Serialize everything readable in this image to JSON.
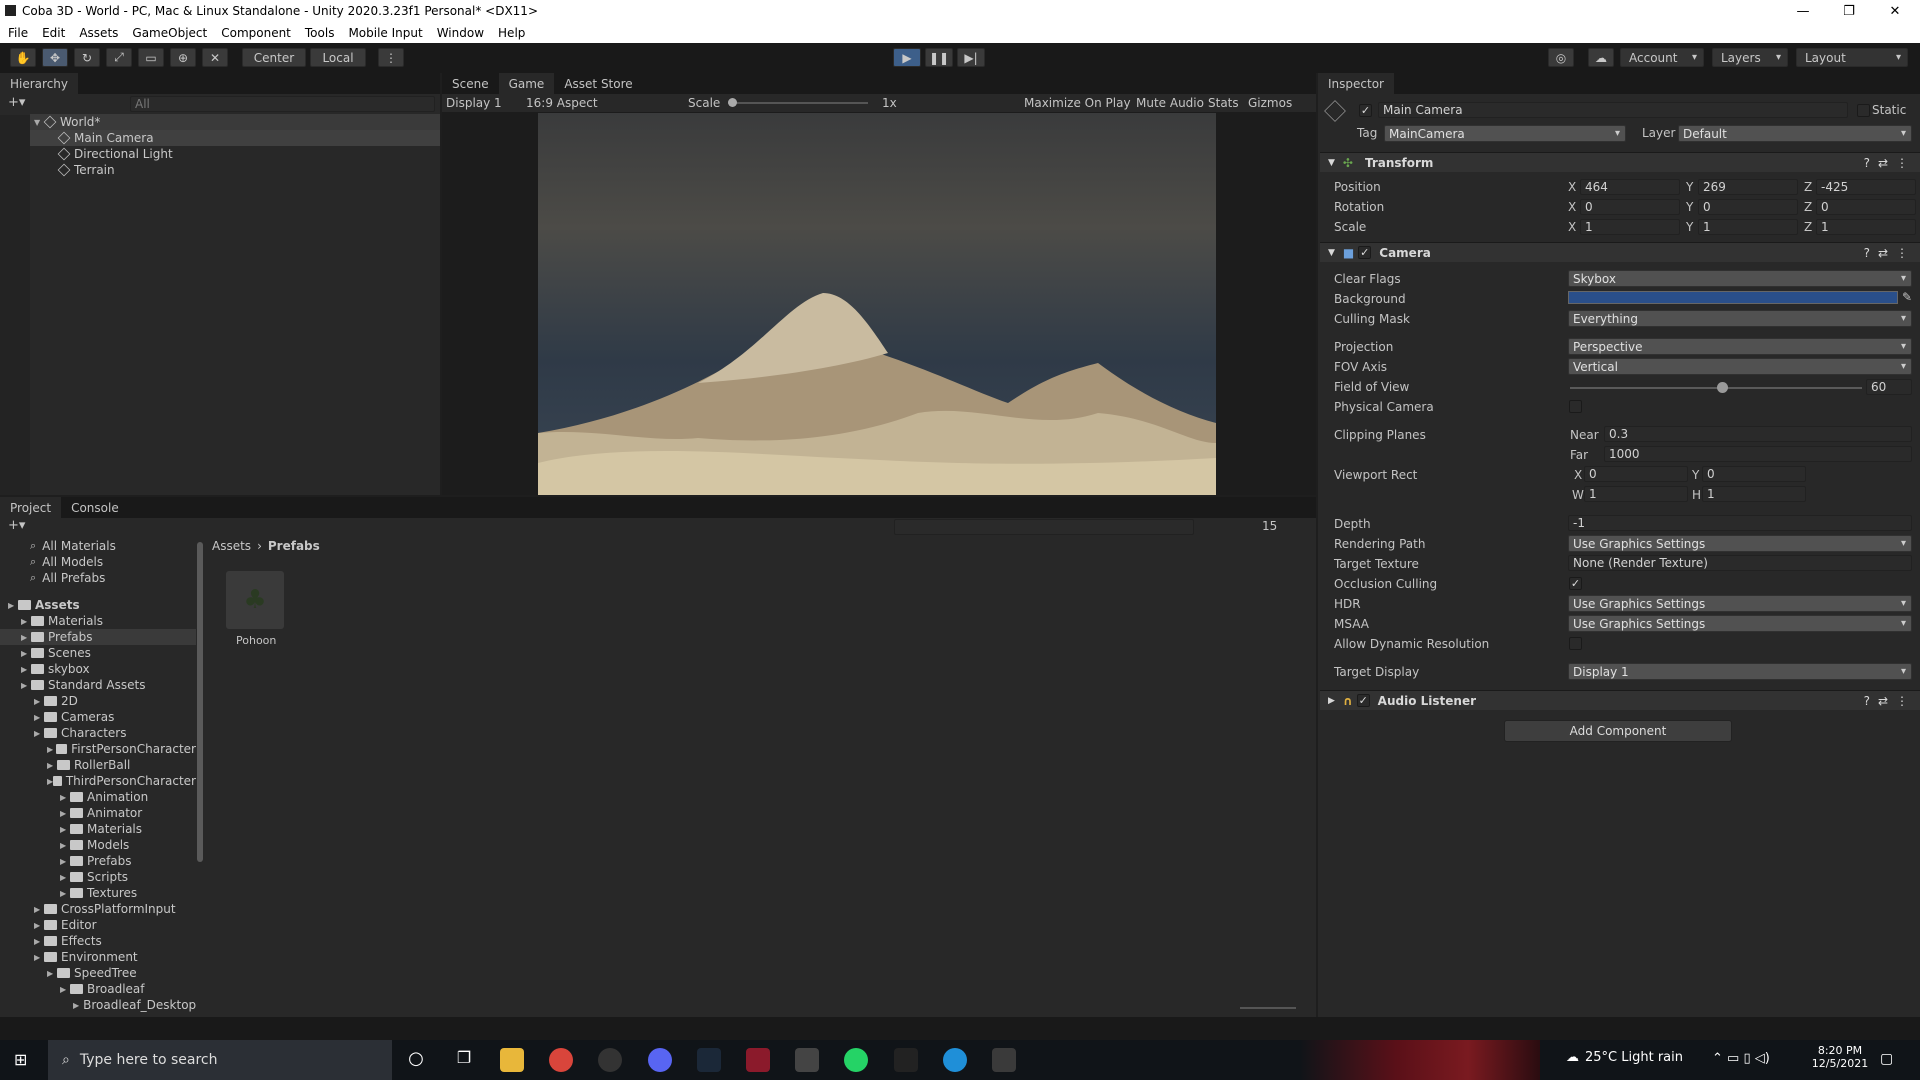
{
  "window": {
    "title": "Coba 3D - World - PC, Mac & Linux Standalone - Unity 2020.3.23f1 Personal* <DX11>"
  },
  "menu": [
    "File",
    "Edit",
    "Assets",
    "GameObject",
    "Component",
    "Tools",
    "Mobile Input",
    "Window",
    "Help"
  ],
  "toolbar": {
    "center": "Center",
    "local": "Local",
    "account": "Account",
    "layers": "Layers",
    "layout": "Layout"
  },
  "hierarchy": {
    "tab": "Hierarchy",
    "search_placeholder": "All",
    "scene": "World*",
    "items": [
      "Main Camera",
      "Directional Light",
      "Terrain"
    ]
  },
  "scene_tabs": [
    "Scene",
    "Game",
    "Asset Store"
  ],
  "game_bar": {
    "display": "Display 1",
    "aspect": "16:9 Aspect",
    "scale_label": "Scale",
    "scale_value": "1x",
    "maximize": "Maximize On Play",
    "mute": "Mute Audio",
    "stats": "Stats",
    "gizmos": "Gizmos"
  },
  "project": {
    "tabs": [
      "Project",
      "Console"
    ],
    "favorites": [
      "All Materials",
      "All Models",
      "All Prefabs"
    ],
    "tree": [
      {
        "label": "Assets",
        "depth": 0,
        "bold": true
      },
      {
        "label": "Materials",
        "depth": 1
      },
      {
        "label": "Prefabs",
        "depth": 1,
        "selected": true
      },
      {
        "label": "Scenes",
        "depth": 1
      },
      {
        "label": "skybox",
        "depth": 1
      },
      {
        "label": "Standard Assets",
        "depth": 1
      },
      {
        "label": "2D",
        "depth": 2
      },
      {
        "label": "Cameras",
        "depth": 2
      },
      {
        "label": "Characters",
        "depth": 2
      },
      {
        "label": "FirstPersonCharacter",
        "depth": 3
      },
      {
        "label": "RollerBall",
        "depth": 3
      },
      {
        "label": "ThirdPersonCharacter",
        "depth": 3
      },
      {
        "label": "Animation",
        "depth": 4
      },
      {
        "label": "Animator",
        "depth": 4
      },
      {
        "label": "Materials",
        "depth": 4
      },
      {
        "label": "Models",
        "depth": 4
      },
      {
        "label": "Prefabs",
        "depth": 4
      },
      {
        "label": "Scripts",
        "depth": 4
      },
      {
        "label": "Textures",
        "depth": 4
      },
      {
        "label": "CrossPlatformInput",
        "depth": 2
      },
      {
        "label": "Editor",
        "depth": 2
      },
      {
        "label": "Effects",
        "depth": 2
      },
      {
        "label": "Environment",
        "depth": 2
      },
      {
        "label": "SpeedTree",
        "depth": 3
      },
      {
        "label": "Broadleaf",
        "depth": 4
      },
      {
        "label": "Broadleaf_Desktop",
        "depth": 5
      }
    ],
    "breadcrumb": [
      "Assets",
      "Prefabs"
    ],
    "asset": "Pohoon",
    "hidden_count": "15"
  },
  "inspector": {
    "tab": "Inspector",
    "object_name": "Main Camera",
    "static": "Static",
    "tag_label": "Tag",
    "tag": "MainCamera",
    "layer_label": "Layer",
    "layer": "Default",
    "transform": {
      "title": "Transform",
      "rows": [
        {
          "label": "Position",
          "x": "464",
          "y": "269",
          "z": "-425"
        },
        {
          "label": "Rotation",
          "x": "0",
          "y": "0",
          "z": "0"
        },
        {
          "label": "Scale",
          "x": "1",
          "y": "1",
          "z": "1"
        }
      ]
    },
    "camera": {
      "title": "Camera",
      "clear_flags": {
        "label": "Clear Flags",
        "value": "Skybox"
      },
      "background": {
        "label": "Background",
        "color": "#2a4f8a"
      },
      "culling_mask": {
        "label": "Culling Mask",
        "value": "Everything"
      },
      "projection": {
        "label": "Projection",
        "value": "Perspective"
      },
      "fov_axis": {
        "label": "FOV Axis",
        "value": "Vertical"
      },
      "fov": {
        "label": "Field of View",
        "value": "60",
        "fraction": 0.52
      },
      "physical": {
        "label": "Physical Camera"
      },
      "clipping": {
        "label": "Clipping Planes",
        "near_label": "Near",
        "near": "0.3",
        "far_label": "Far",
        "far": "1000"
      },
      "viewport": {
        "label": "Viewport Rect",
        "x": "0",
        "y": "0",
        "w": "1",
        "h": "1"
      },
      "depth": {
        "label": "Depth",
        "value": "-1"
      },
      "rendering_path": {
        "label": "Rendering Path",
        "value": "Use Graphics Settings"
      },
      "target_texture": {
        "label": "Target Texture",
        "value": "None (Render Texture)"
      },
      "occlusion": {
        "label": "Occlusion Culling"
      },
      "hdr": {
        "label": "HDR",
        "value": "Use Graphics Settings"
      },
      "msaa": {
        "label": "MSAA",
        "value": "Use Graphics Settings"
      },
      "dynamic_res": {
        "label": "Allow Dynamic Resolution"
      },
      "target_display": {
        "label": "Target Display",
        "value": "Display 1"
      }
    },
    "audio_listener": "Audio Listener",
    "add_component": "Add Component"
  },
  "taskbar": {
    "search": "Type here to search",
    "weather": "25°C  Light rain",
    "time": "8:20 PM",
    "date": "12/5/2021"
  }
}
